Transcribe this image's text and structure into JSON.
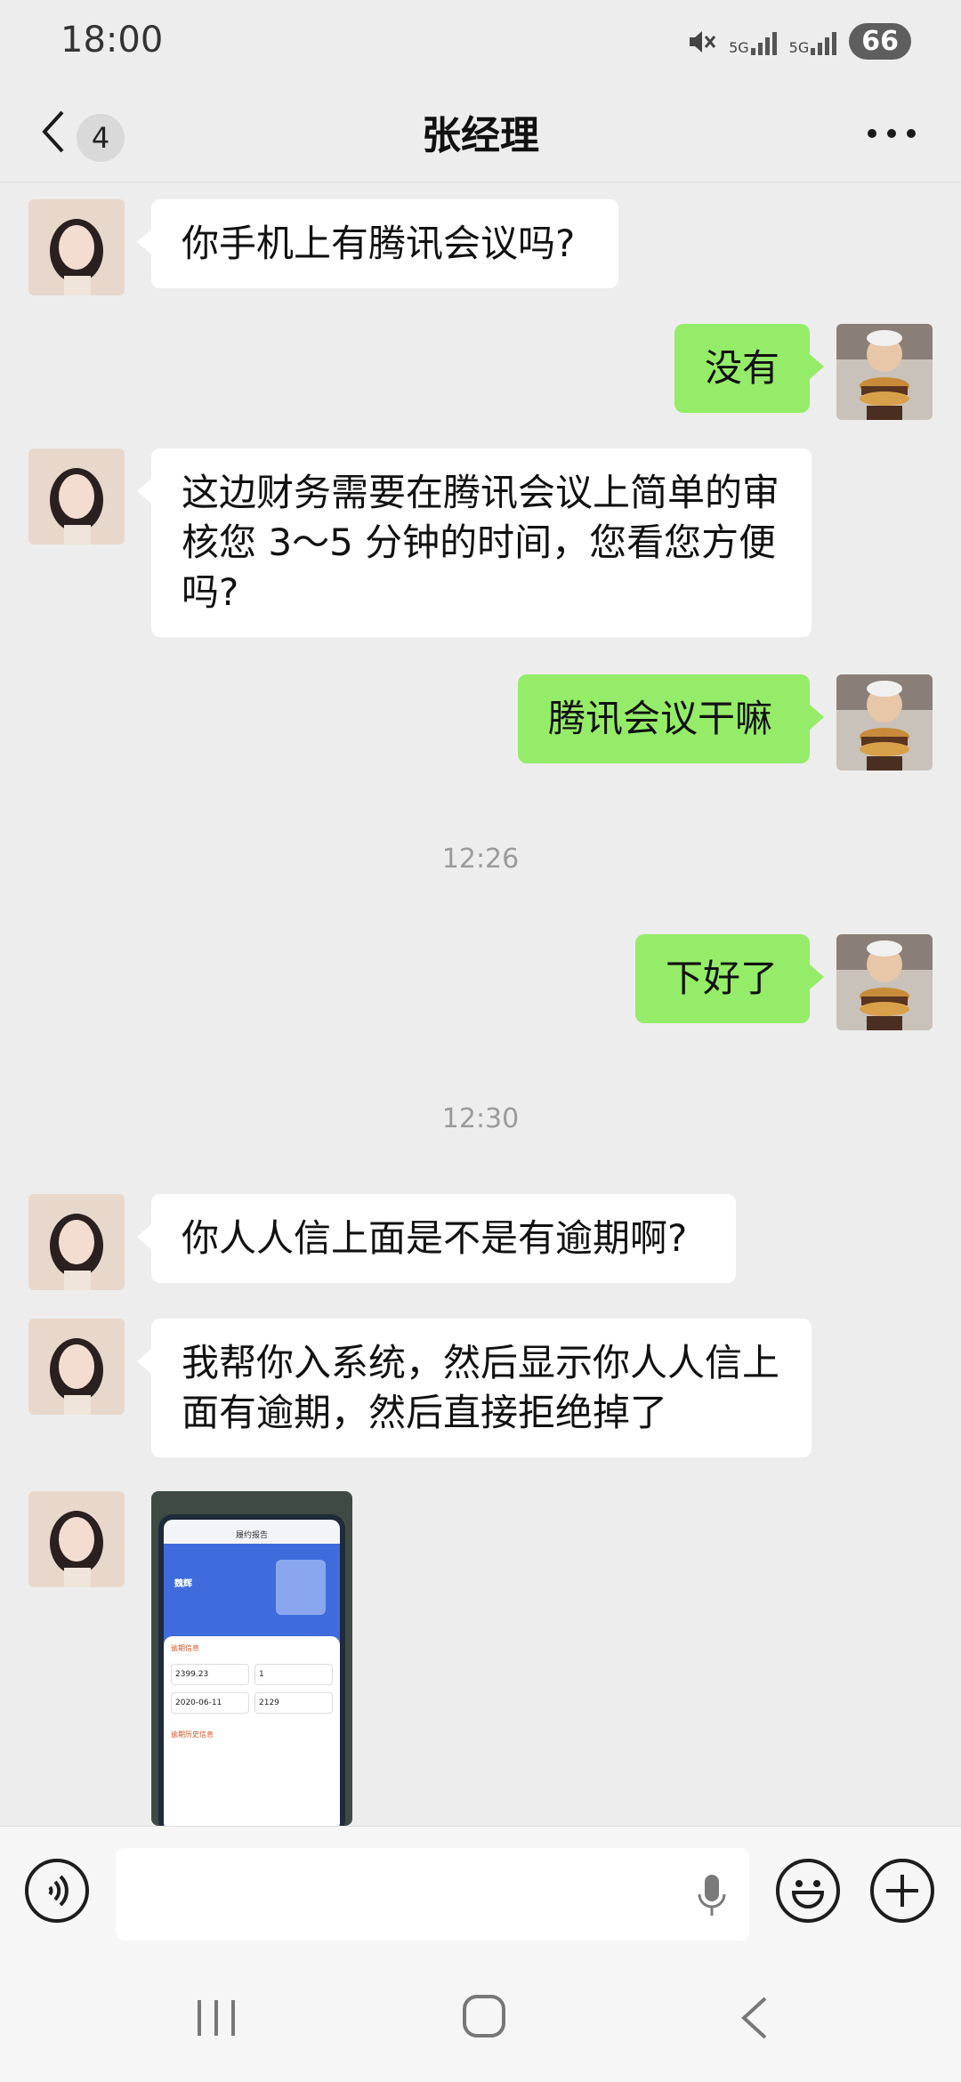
{
  "status_bar": {
    "time": "18:00",
    "network_1": "5G",
    "network_2": "5G",
    "battery": "66"
  },
  "header": {
    "unread_count": "4",
    "title": "张经理"
  },
  "messages": [
    {
      "side": "in",
      "text": "你手机上有腾讯会议吗?"
    },
    {
      "side": "out",
      "text": "没有"
    },
    {
      "side": "in",
      "text": "这边财务需要在腾讯会议上简单的审核您 3～5 分钟的时间，您看您方便吗?"
    },
    {
      "side": "out",
      "text": "腾讯会议干嘛"
    },
    {
      "side": "out",
      "text": "下好了"
    },
    {
      "side": "in",
      "text": "你人人信上面是不是有逾期啊?"
    },
    {
      "side": "in",
      "text": "我帮你入系统，然后显示你人人信上面有逾期，然后直接拒绝掉了"
    },
    {
      "side": "in",
      "type": "image",
      "image": {
        "screen_title": "履约报告",
        "name": "魏辉",
        "section": "逾期信息",
        "amount": "2399.23",
        "count": "1",
        "date": "2020-06-11",
        "days": "2129",
        "history": "逾期历史信息"
      }
    }
  ],
  "timestamps": [
    "12:26",
    "12:30"
  ],
  "colors": {
    "background": "#ededed",
    "bubble_out": "#95ec69",
    "bubble_in": "#ffffff"
  },
  "icons": [
    "back-icon",
    "more-icon",
    "voice-icon",
    "mic-icon",
    "emoji-icon",
    "plus-icon",
    "recent-apps-icon",
    "home-icon",
    "nav-back-icon"
  ]
}
